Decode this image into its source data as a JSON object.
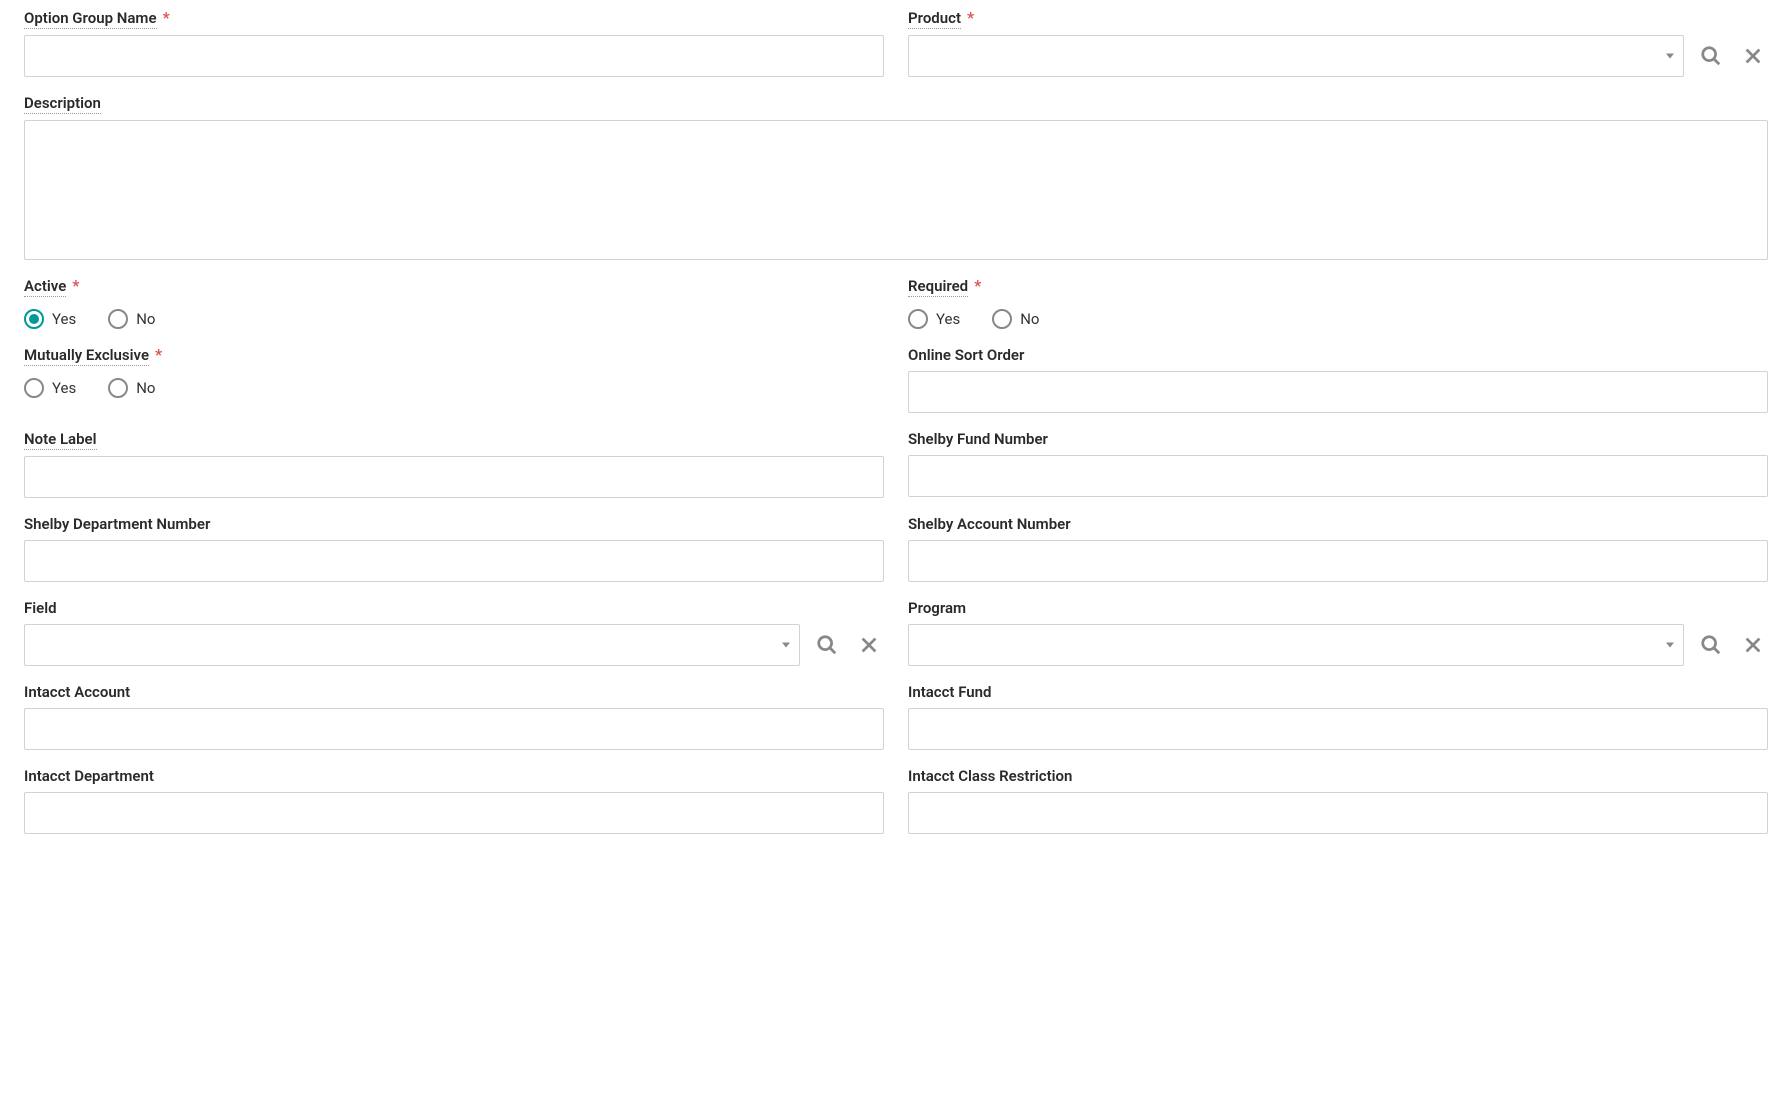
{
  "fields": {
    "option_group_name": {
      "label": "Option Group Name",
      "required": true
    },
    "product": {
      "label": "Product",
      "required": true
    },
    "description": {
      "label": "Description",
      "required": false
    },
    "active": {
      "label": "Active",
      "required": true,
      "options": [
        "Yes",
        "No"
      ],
      "selected": "Yes"
    },
    "required": {
      "label": "Required",
      "required": true,
      "options": [
        "Yes",
        "No"
      ],
      "selected": null
    },
    "mutually_exclusive": {
      "label": "Mutually Exclusive",
      "required": true,
      "options": [
        "Yes",
        "No"
      ],
      "selected": null
    },
    "online_sort_order": {
      "label": "Online Sort Order",
      "required": false
    },
    "note_label": {
      "label": "Note Label",
      "required": false
    },
    "shelby_fund_number": {
      "label": "Shelby Fund Number",
      "required": false
    },
    "shelby_department_number": {
      "label": "Shelby Department Number",
      "required": false
    },
    "shelby_account_number": {
      "label": "Shelby Account Number",
      "required": false
    },
    "field": {
      "label": "Field",
      "required": false
    },
    "program": {
      "label": "Program",
      "required": false
    },
    "intacct_account": {
      "label": "Intacct Account",
      "required": false
    },
    "intacct_fund": {
      "label": "Intacct Fund",
      "required": false
    },
    "intacct_department": {
      "label": "Intacct Department",
      "required": false
    },
    "intacct_class_restriction": {
      "label": "Intacct Class Restriction",
      "required": false
    }
  },
  "asterisk": "*"
}
